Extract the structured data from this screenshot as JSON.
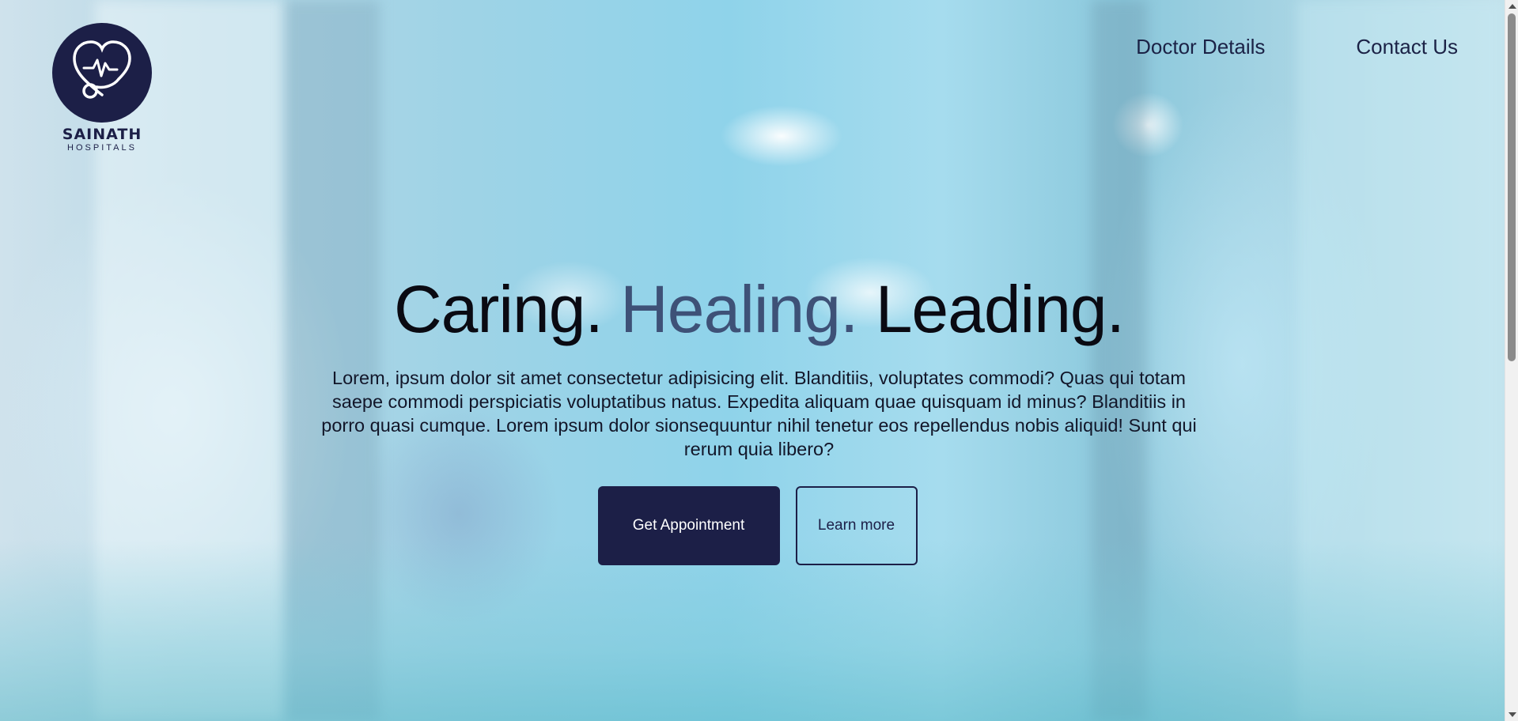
{
  "brand": {
    "name": "SAINATH",
    "sub": "HOSPITALS",
    "logo_icon": "heart-stethoscope-icon",
    "color": "#1c1f47"
  },
  "nav": {
    "items": [
      {
        "label": "Doctor Details"
      },
      {
        "label": "Contact Us"
      }
    ]
  },
  "hero": {
    "headline": {
      "part1": "Caring.",
      "part2": "Healing.",
      "part3": "Leading."
    },
    "accent_color": "#3e5177",
    "description": "Lorem, ipsum dolor sit amet consectetur adipisicing elit. Blanditiis, voluptates commodi? Quas qui totam saepe commodi perspiciatis voluptatibus natus. Expedita aliquam quae quisquam id minus? Blanditiis in porro quasi cumque. Lorem ipsum dolor sionsequuntur nihil tenetur eos repellendus nobis aliquid! Sunt qui rerum quia libero?",
    "primary_button": "Get Appointment",
    "secondary_button": "Learn more"
  }
}
